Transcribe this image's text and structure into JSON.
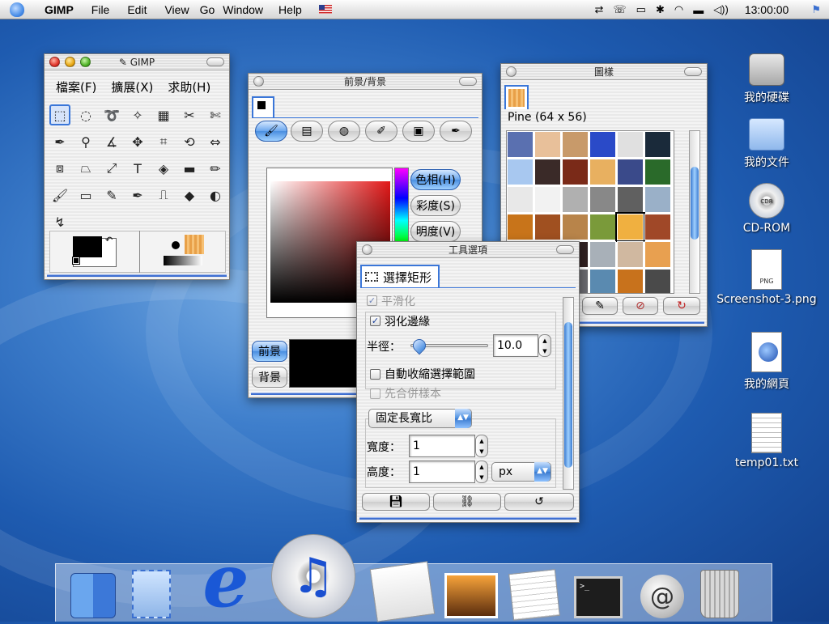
{
  "menubar": {
    "app_name": "GIMP",
    "items": [
      "File",
      "Edit",
      "View",
      "Go",
      "Window",
      "Help"
    ],
    "clock": "13:00:00"
  },
  "toolbox": {
    "title": "GIMP",
    "menu": [
      "檔案(F)",
      "擴展(X)",
      "求助(H)"
    ],
    "tools": [
      "rect-select",
      "ellipse-select",
      "lasso",
      "fuzzy-select",
      "by-color-select",
      "scissors",
      "iscissors",
      "color-picker",
      "magnify",
      "measure",
      "move",
      "crop",
      "transform",
      "flip",
      "perspective",
      "shear",
      "resize",
      "text",
      "bucket-fill",
      "blend",
      "pencil",
      "paintbrush",
      "eraser",
      "airbrush",
      "ink",
      "clone",
      "convolve",
      "dodge-burn",
      "smudge"
    ]
  },
  "fgbg": {
    "title": "前景/背景",
    "modes": [
      "色相(H)",
      "彩度(S)",
      "明度(V)"
    ],
    "fg_label": "前景",
    "bg_label": "背景",
    "fg_color": "#000000"
  },
  "patterns": {
    "title": "圖樣",
    "current": "Pine (64 x 56)"
  },
  "tool_options": {
    "title": "工具選項",
    "tool_name": "選擇矩形",
    "antialias": "平滑化",
    "feather": "羽化邊緣",
    "radius_label": "半徑：",
    "radius_value": "10.0",
    "auto_shrink": "自動收縮選擇範圍",
    "sample_merged": "先合併樣本",
    "fixed_ratio": "固定長寬比",
    "width_label": "寬度：",
    "width_value": "1",
    "height_label": "高度：",
    "height_value": "1",
    "unit": "px"
  },
  "desktop": {
    "icons": [
      "我的硬碟",
      "我的文件",
      "CD-ROM",
      "Screenshot-3.png",
      "我的網頁",
      "temp01.txt"
    ],
    "cd_disc_text": "CDR",
    "png_badge": "PNG"
  },
  "dock": [
    "Finder",
    "Mail",
    "Internet Explorer",
    "iTunes",
    "iPhoto",
    "Image Capture",
    "TextEdit",
    "Terminal",
    "Mail Server",
    "Trash"
  ]
}
